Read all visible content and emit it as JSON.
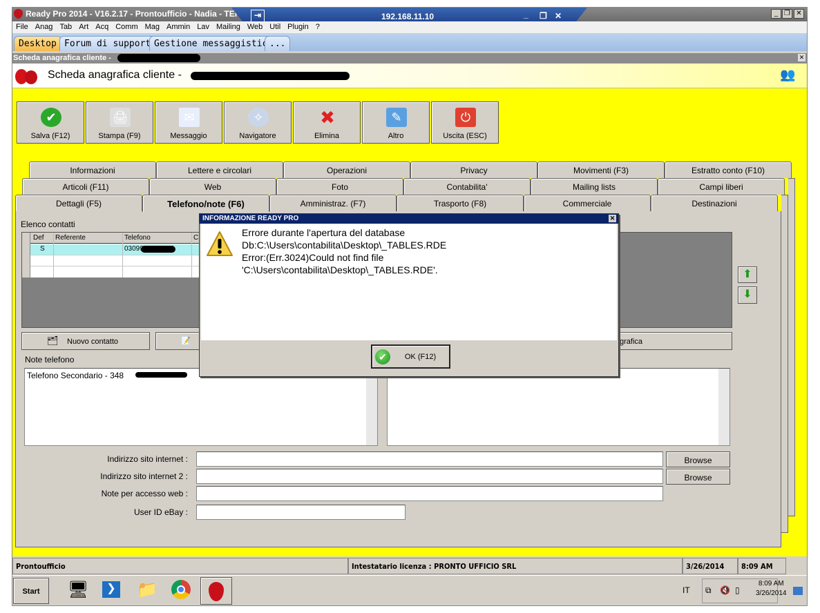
{
  "window": {
    "title": "Ready Pro 2014 - V16.2.17 - Prontoufficio - Nadia - TER",
    "rdp_host": "192.168.11.10"
  },
  "menu": [
    "File",
    "Anag",
    "Tab",
    "Art",
    "Acq",
    "Comm",
    "Mag",
    "Ammin",
    "Lav",
    "Mailing",
    "Web",
    "Util",
    "Plugin",
    "?"
  ],
  "desktop_tabs": [
    "Desktop",
    "Forum di supporto",
    "Gestione messaggistica",
    "..."
  ],
  "mdi_title": "Scheda anagrafica cliente - ",
  "header_title": "Scheda anagrafica cliente - ",
  "toolbar": [
    {
      "label": "Salva (F12)",
      "icon": "check-icon"
    },
    {
      "label": "Stampa (F9)",
      "icon": "printer-icon"
    },
    {
      "label": "Messaggio",
      "icon": "envelope-icon"
    },
    {
      "label": "Navigatore",
      "icon": "compass-icon"
    },
    {
      "label": "Elimina",
      "icon": "x-icon"
    },
    {
      "label": "Altro",
      "icon": "tools-icon"
    },
    {
      "label": "Uscita (ESC)",
      "icon": "power-icon"
    }
  ],
  "tabs_row1": [
    "Informazioni",
    "Lettere e circolari",
    "Operazioni",
    "Privacy",
    "Movimenti (F3)",
    "Estratto conto (F10)"
  ],
  "tabs_row2": [
    "Articoli (F11)",
    "Web",
    "Foto",
    "Contabilita'",
    "Mailing lists",
    "Campi liberi"
  ],
  "tabs_row3": [
    "Dettagli (F5)",
    "Telefono/note (F6)",
    "Amministraz. (F7)",
    "Trasporto (F8)",
    "Commerciale",
    "Destinazioni"
  ],
  "contacts": {
    "label": "Elenco contatti",
    "columns": [
      "Def",
      "Referente",
      "Telefono",
      "C"
    ],
    "rows": [
      {
        "def": "S",
        "referente": "",
        "telefono": "030995"
      }
    ]
  },
  "buttons": {
    "new_contact": "Nuovo contatto",
    "right_btn": "grafica"
  },
  "notes": {
    "label": "Note telefono",
    "value": "Telefono Secondario - 348"
  },
  "fields": [
    {
      "label": "Indirizzo sito internet :",
      "value": "",
      "browse": "Browse"
    },
    {
      "label": "Indirizzo sito internet 2 :",
      "value": "",
      "browse": "Browse"
    },
    {
      "label": "Note per accesso web :",
      "value": ""
    },
    {
      "label": "User ID eBay :",
      "value": ""
    }
  ],
  "status": {
    "app": "Prontoufficio",
    "license": "Intestatario licenza : PRONTO UFFICIO SRL",
    "date": "3/26/2014",
    "time": "8:09 AM"
  },
  "taskbar": {
    "start": "Start",
    "lang": "IT",
    "clock_time": "8:09 AM",
    "clock_date": "3/26/2014"
  },
  "dialog": {
    "title": "INFORMAZIONE READY PRO",
    "lines": [
      "Errore durante l'apertura del database",
      "Db:C:\\Users\\contabilita\\Desktop\\_TABLES.RDE",
      "Error:(Err.3024)Could not find file",
      "'C:\\Users\\contabilita\\Desktop\\_TABLES.RDE'."
    ],
    "ok": "OK (F12)"
  },
  "colors": {
    "background_yellow": "#ffff00",
    "dialog_title": "#0a246a",
    "selected_row": "#aef0f0"
  }
}
